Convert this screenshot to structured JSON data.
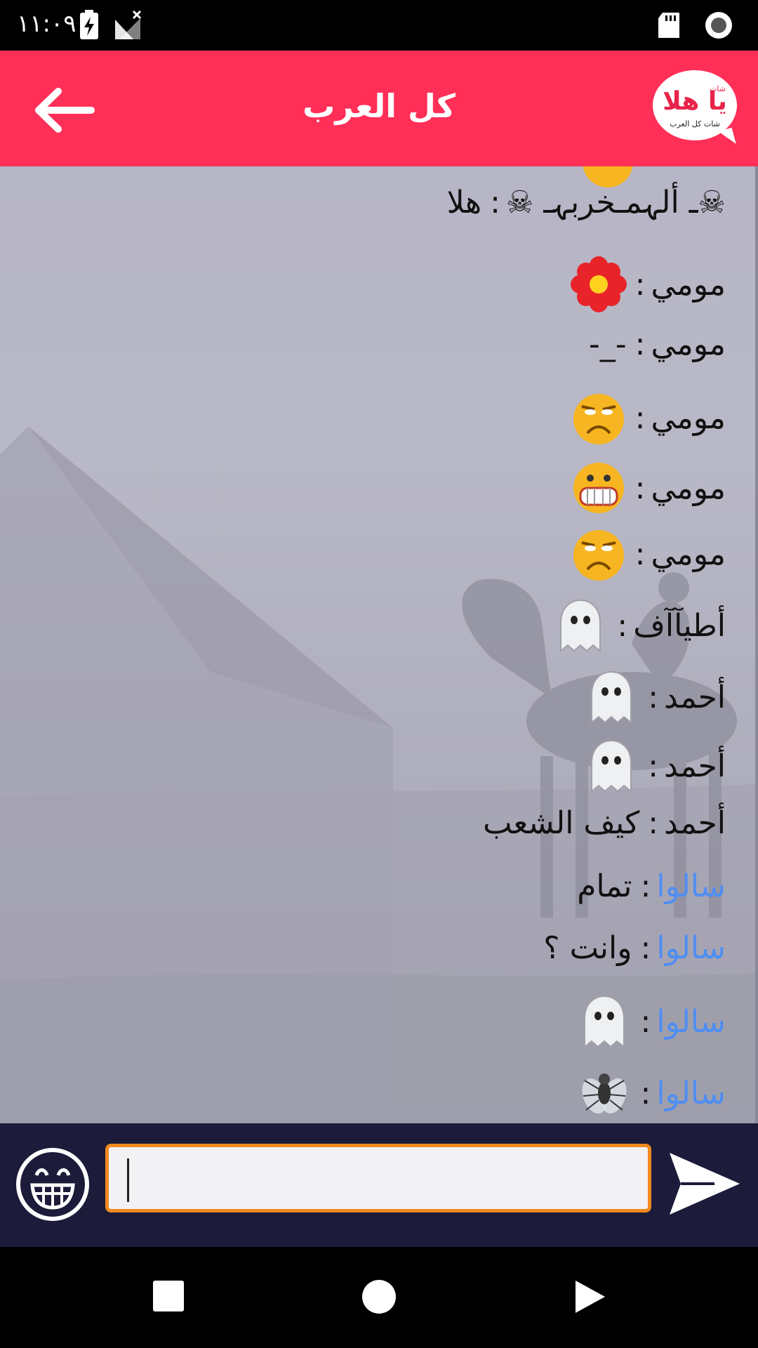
{
  "status_bar": {
    "time": "١١:٠٩",
    "icons": [
      "battery-charging-icon",
      "no-signal-icon",
      "sd-card-icon",
      "record-icon"
    ]
  },
  "header": {
    "title": "كل العرب",
    "back_icon": "arrow-left-icon",
    "logo": {
      "brand": "يا هلا",
      "small": "شات",
      "sub": "شات كل العرب"
    },
    "color": "#ff2f58"
  },
  "messages": [
    {
      "sender": "☠ـ ألہمـخربہـ ☠",
      "text": "هلا",
      "emoji": null,
      "sender_color": "#111111"
    },
    {
      "sender": "مومي",
      "text": "",
      "emoji": "flower-icon",
      "sender_color": "#111111"
    },
    {
      "sender": "مومي",
      "text": "-_-",
      "emoji": null,
      "sender_color": "#111111"
    },
    {
      "sender": "مومي",
      "text": "",
      "emoji": "frown-face-icon",
      "sender_color": "#111111"
    },
    {
      "sender": "مومي",
      "text": "",
      "emoji": "grimace-face-icon",
      "sender_color": "#111111"
    },
    {
      "sender": "مومي",
      "text": "",
      "emoji": "frown-face-icon",
      "sender_color": "#111111"
    },
    {
      "sender": "أطيآآف",
      "text": "",
      "emoji": "ghost-icon",
      "sender_color": "#111111"
    },
    {
      "sender": "أحمد",
      "text": "",
      "emoji": "ghost-icon",
      "sender_color": "#111111"
    },
    {
      "sender": "أحمد",
      "text": "",
      "emoji": "ghost-icon",
      "sender_color": "#111111"
    },
    {
      "sender": "أحمد",
      "text": "كيف الشعب",
      "emoji": null,
      "sender_color": "#111111"
    },
    {
      "sender": "سالوا",
      "text": "تمام",
      "emoji": null,
      "sender_color": "#4f8ef2"
    },
    {
      "sender": "سالوا",
      "text": "وانت ؟",
      "emoji": null,
      "sender_color": "#4f8ef2"
    },
    {
      "sender": "سالوا",
      "text": "",
      "emoji": "ghost-icon",
      "sender_color": "#4f8ef2"
    },
    {
      "sender": "سالوا",
      "text": "",
      "emoji": "fly-icon",
      "sender_color": "#4f8ef2"
    }
  ],
  "input": {
    "value": "",
    "placeholder": "",
    "emoji_icon": "grin-face-icon",
    "send_icon": "send-icon",
    "border_color": "#f08a1f",
    "bar_color": "#1c1b3a"
  },
  "nav_bar": {
    "icons": [
      "square-recents-icon",
      "circle-home-icon",
      "triangle-back-icon"
    ]
  }
}
